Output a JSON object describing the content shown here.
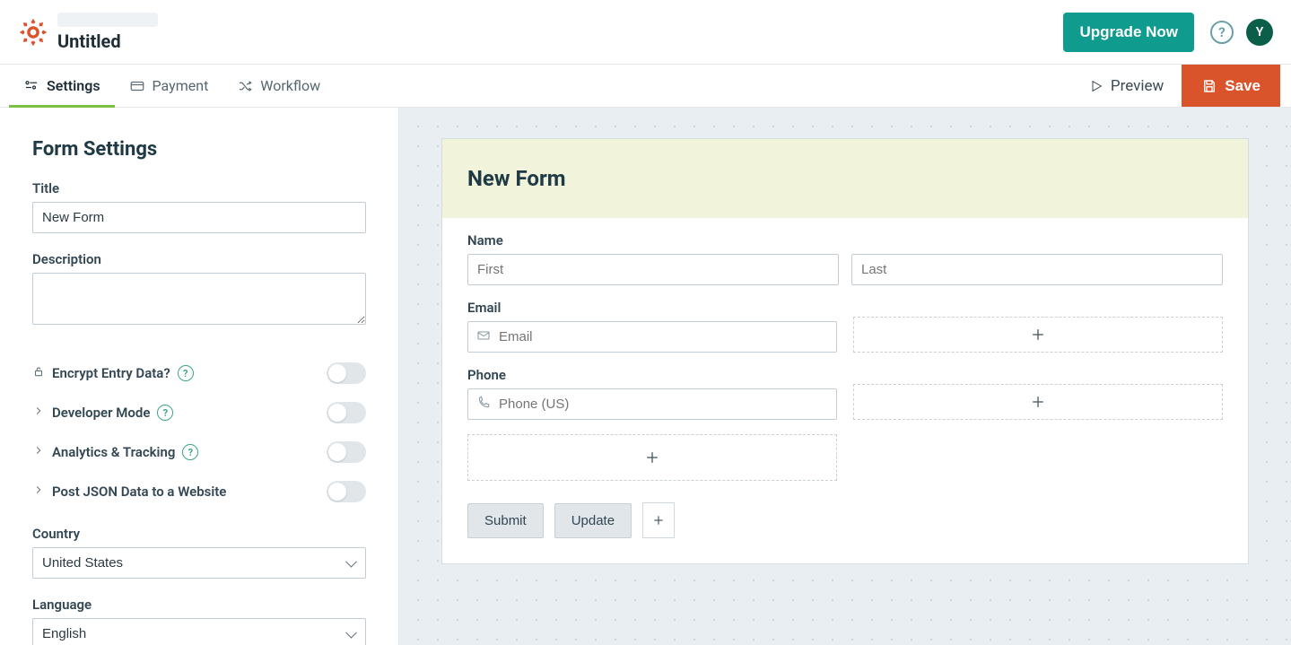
{
  "header": {
    "page_title": "Untitled",
    "upgrade_label": "Upgrade Now",
    "avatar_initial": "Y"
  },
  "tabs": {
    "settings": "Settings",
    "payment": "Payment",
    "workflow": "Workflow",
    "preview": "Preview",
    "save": "Save"
  },
  "sidebar": {
    "heading": "Form Settings",
    "title_label": "Title",
    "title_value": "New Form",
    "description_label": "Description",
    "description_value": "",
    "encrypt_label": "Encrypt Entry Data?",
    "developer_label": "Developer Mode",
    "analytics_label": "Analytics & Tracking",
    "postjson_label": "Post JSON Data to a Website",
    "country_label": "Country",
    "country_value": "United States",
    "language_label": "Language",
    "language_value": "English"
  },
  "form": {
    "title": "New Form",
    "name_label": "Name",
    "first_placeholder": "First",
    "last_placeholder": "Last",
    "email_label": "Email",
    "email_placeholder": "Email",
    "phone_label": "Phone",
    "phone_placeholder": "Phone (US)",
    "submit_label": "Submit",
    "update_label": "Update"
  }
}
